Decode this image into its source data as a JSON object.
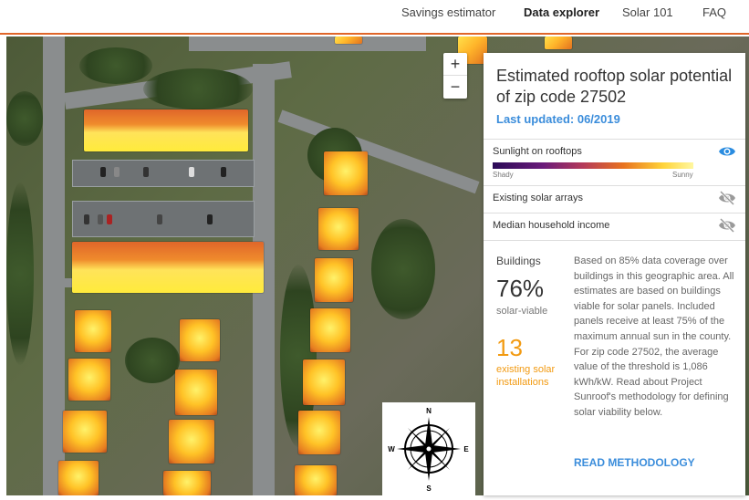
{
  "nav": {
    "items": [
      {
        "label": "Savings estimator",
        "active": false
      },
      {
        "label": "Data explorer",
        "active": true
      },
      {
        "label": "Solar 101",
        "active": false
      },
      {
        "label": "FAQ",
        "active": false
      }
    ],
    "accent_color": "#e0662a"
  },
  "map": {
    "zoom_in_label": "+",
    "zoom_out_label": "−",
    "compass": {
      "n": "N",
      "s": "S",
      "e": "E",
      "w": "W"
    }
  },
  "panel": {
    "title": "Estimated rooftop solar potential of zip code 27502",
    "last_updated": "Last updated: 06/2019",
    "layers": [
      {
        "label": "Sunlight on rooftops",
        "visible": true,
        "icon": "eye-icon"
      },
      {
        "label": "Existing solar arrays",
        "visible": false,
        "icon": "eye-off-icon"
      },
      {
        "label": "Median household income",
        "visible": false,
        "icon": "eye-off-icon"
      }
    ],
    "gradient": {
      "low_label": "Shady",
      "high_label": "Sunny"
    },
    "buildings_label": "Buildings",
    "viable_percent": "76%",
    "viable_label": "solar-viable",
    "installations_count": "13",
    "installations_label": "existing solar installations",
    "description": "Based on 85% data coverage over buildings in this geographic area. All estimates are based on buildings viable for solar panels. Included panels receive at least 75% of the maximum annual sun in the county. For zip code 27502, the average value of the threshold is 1,086 kWh/kW. Read about Project Sunroof's methodology for defining solar viability below.",
    "read_link": "READ METHODOLOGY",
    "link_color": "#3b8ddb",
    "highlight_color": "#f29a11"
  }
}
